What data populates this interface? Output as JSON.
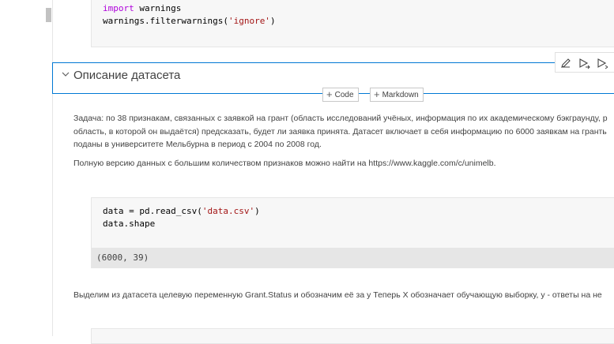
{
  "cell1": {
    "lines": [
      {
        "keyword": "import",
        "rest": " warnings"
      },
      {
        "text": "warnings.filterwarnings(",
        "string": "'ignore'",
        "tail": ")"
      }
    ]
  },
  "markdown_cell": {
    "title": "Описание датасета"
  },
  "cell_toolbar": {
    "icons": [
      "edit-icon",
      "run-by-line-icon",
      "run-icon"
    ]
  },
  "add_buttons": {
    "code_label": "Code",
    "markdown_label": "Markdown"
  },
  "description": {
    "line1": "Задача: по 38 признакам, связанных с заявкой на грант (область исследований учёных, информация по их академическому бэкграунду, р",
    "line2": "область, в которой он выдаётся) предсказать, будет ли заявка принята. Датасет включает в себя информацию по 6000 заявкам на гранть",
    "line3": "поданы в университете Мельбурна в период с 2004 по 2008 год.",
    "line4": "Полную версию данных с большим количеством признаков можно найти на https://www.kaggle.com/c/unimelb."
  },
  "cell2": {
    "line1_code": "data = pd.read_csv(",
    "line1_string": "'data.csv'",
    "line1_tail": ")",
    "line2": "data.shape",
    "output": "(6000, 39)"
  },
  "target_text": "Выделим из датасета целевую переменную Grant.Status и обозначим её за y Теперь X обозначает обучающую выборку, y - ответы на не"
}
